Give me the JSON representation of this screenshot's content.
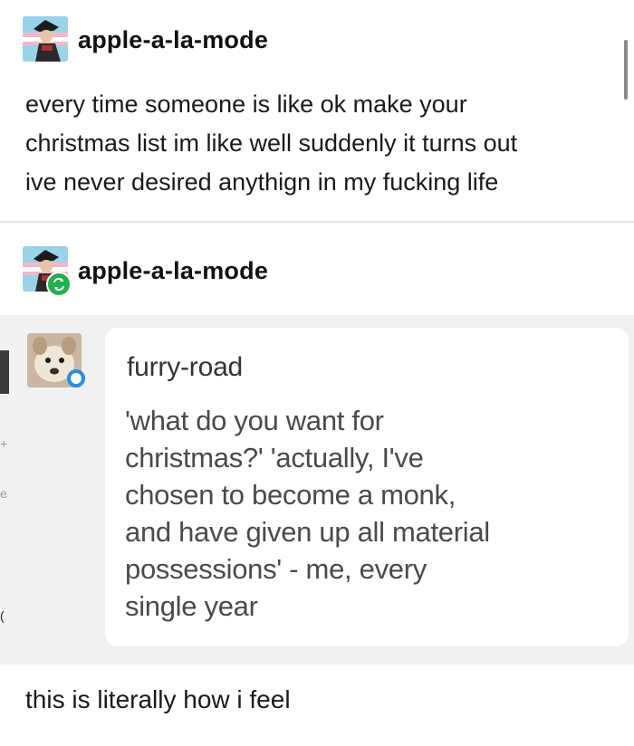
{
  "original_post": {
    "username": "apple-a-la-mode",
    "avatar_icon": "pirate-avatar-icon",
    "lines": [
      "every time someone is like ok make your",
      "christmas list im like well suddenly it turns out",
      "ive never desired anythign in my fucking life"
    ]
  },
  "reblog": {
    "username": "apple-a-la-mode",
    "avatar_icon": "pirate-avatar-icon",
    "badge_icon": "reblog-icon"
  },
  "quoted_post": {
    "username": "furry-road",
    "avatar_icon": "dog-avatar-icon",
    "lines": [
      "'what do you want for",
      "christmas?' 'actually, I've",
      "chosen to become a monk,",
      "and have given up all material",
      "possessions' - me, every",
      "single year"
    ]
  },
  "caption": "this is literally how i feel",
  "colors": {
    "reblog_badge": "#21b04a",
    "status_badge": "#2a8be6",
    "gray_band": "#f1f1f1"
  }
}
